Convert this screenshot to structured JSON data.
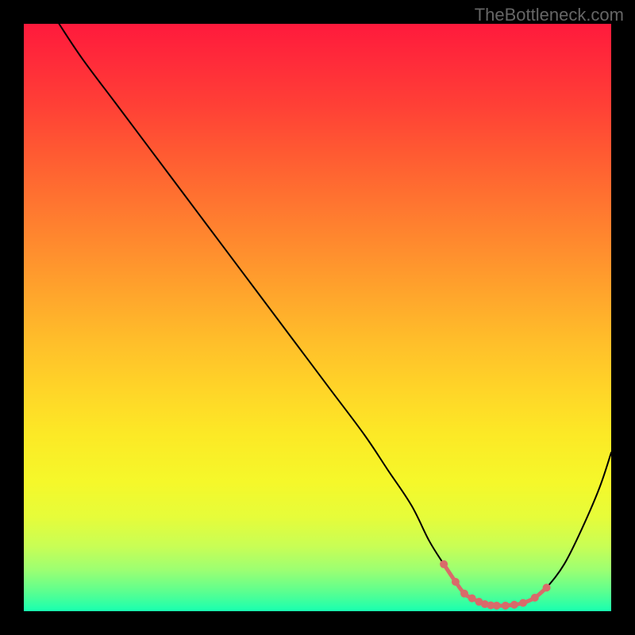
{
  "watermark": "TheBottleneck.com",
  "chart_data": {
    "type": "line",
    "title": "",
    "xlabel": "",
    "ylabel": "",
    "xlim": [
      0,
      100
    ],
    "ylim": [
      0,
      100
    ],
    "series": [
      {
        "name": "curve",
        "x": [
          6,
          10,
          16,
          22,
          28,
          34,
          40,
          46,
          52,
          58,
          62,
          66,
          69,
          71.5,
          73.5,
          75,
          77,
          79,
          81,
          83,
          85,
          87,
          89,
          92,
          95,
          98,
          100
        ],
        "y": [
          100,
          94,
          86,
          78,
          70,
          62,
          54,
          46,
          38,
          30,
          24,
          18,
          12,
          8,
          5,
          3,
          1.8,
          1.1,
          0.9,
          1.0,
          1.3,
          2.2,
          4,
          8,
          14,
          21,
          27
        ],
        "stroke": "#000000",
        "stroke_width": 2
      }
    ],
    "markers": {
      "name": "bottom-cluster",
      "color": "#d96a6a",
      "radius": 5,
      "x": [
        71.5,
        73.5,
        75,
        76.3,
        77.5,
        78.5,
        79.5,
        80.5,
        82,
        83.5,
        85,
        87,
        89
      ],
      "y": [
        8,
        5,
        3,
        2.2,
        1.6,
        1.2,
        1.0,
        0.95,
        0.95,
        1.1,
        1.4,
        2.3,
        4
      ]
    },
    "gradient_stops": [
      {
        "pct": 0,
        "color": "#ff1a3c"
      },
      {
        "pct": 6,
        "color": "#ff2a3a"
      },
      {
        "pct": 14,
        "color": "#ff4036"
      },
      {
        "pct": 22,
        "color": "#ff5a32"
      },
      {
        "pct": 30,
        "color": "#ff7330"
      },
      {
        "pct": 38,
        "color": "#ff8c2e"
      },
      {
        "pct": 46,
        "color": "#ffa52c"
      },
      {
        "pct": 54,
        "color": "#ffbe2a"
      },
      {
        "pct": 62,
        "color": "#ffd428"
      },
      {
        "pct": 70,
        "color": "#fce926"
      },
      {
        "pct": 78,
        "color": "#f5f82a"
      },
      {
        "pct": 84,
        "color": "#e6fc3a"
      },
      {
        "pct": 89,
        "color": "#c8fe55"
      },
      {
        "pct": 93,
        "color": "#9cff72"
      },
      {
        "pct": 96.5,
        "color": "#5fff8e"
      },
      {
        "pct": 100,
        "color": "#18ffb0"
      }
    ]
  }
}
